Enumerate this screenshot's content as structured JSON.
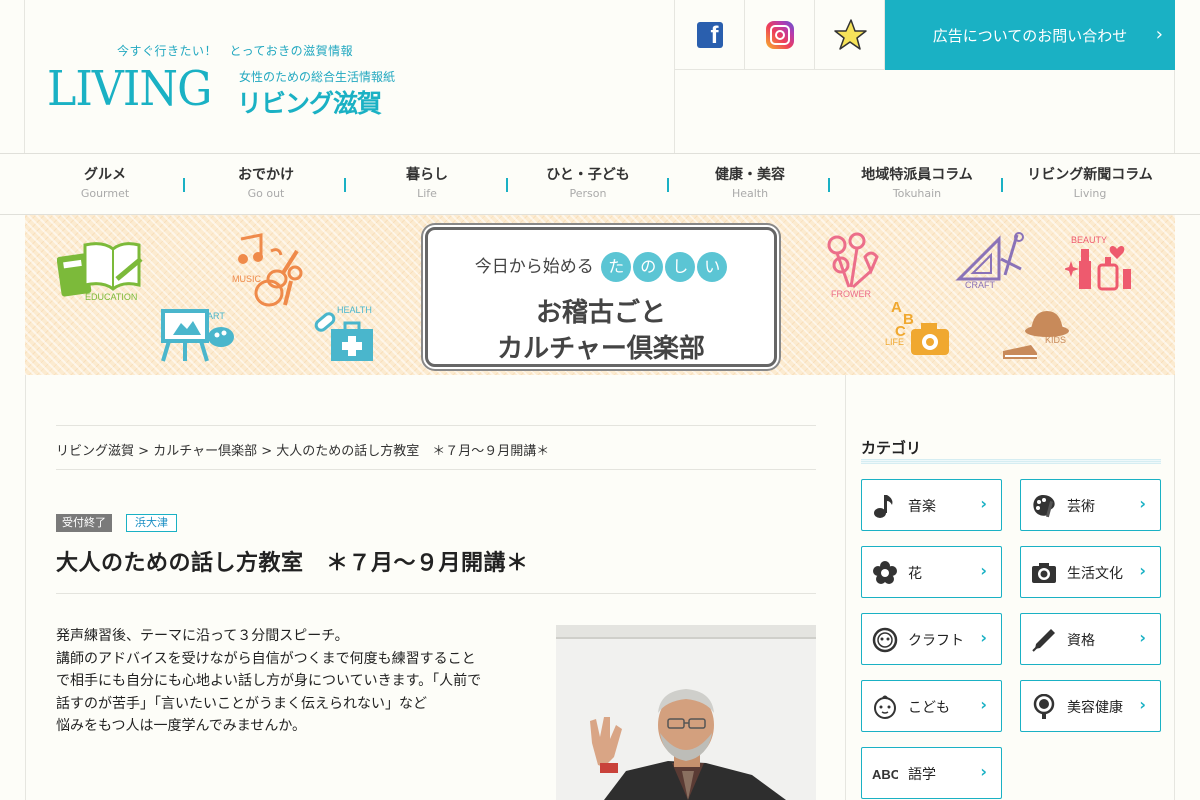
{
  "header": {
    "tagline": "今すぐ行きたい！　とっておきの滋賀情報",
    "logo_living": "LIVING",
    "logo_subtitle": "女性のための総合生活情報紙",
    "logo_name": "リビング滋賀",
    "ad_contact_label": "広告についてのお問い合わせ",
    "social": [
      "facebook-icon",
      "instagram-icon",
      "star-icon"
    ]
  },
  "nav": [
    {
      "jp": "グルメ",
      "en": "Gourmet"
    },
    {
      "jp": "おでかけ",
      "en": "Go out"
    },
    {
      "jp": "暮らし",
      "en": "Life"
    },
    {
      "jp": "ひと・子ども",
      "en": "Person"
    },
    {
      "jp": "健康・美容",
      "en": "Health"
    },
    {
      "jp": "地域特派員コラム",
      "en": "Tokuhain"
    },
    {
      "jp": "リビング新聞コラム",
      "en": "Living"
    }
  ],
  "banner": {
    "lead": "今日から始める",
    "tanoshii": [
      "た",
      "の",
      "し",
      "い"
    ],
    "title_line1": "お稽古ごと",
    "title_line2": "カルチャー倶楽部",
    "labels": {
      "education": "EDUCATION",
      "music": "MUSIC",
      "art": "ART",
      "health": "HEALTH",
      "flower": "FROWER",
      "craft": "CRAFT",
      "beauty": "BEAUTY",
      "life": "LIFE",
      "kids": "KIDS",
      "abc": [
        "A",
        "B",
        "C"
      ]
    },
    "colors": {
      "education": "#7cba3a",
      "music": "#ef8a4a",
      "art": "#4ab6cc",
      "health": "#4ab6cc",
      "flower": "#ec6e8a",
      "craft": "#8a72b8",
      "beauty": "#ee5a6e",
      "life": "#f0a830",
      "kids": "#c88a5a"
    }
  },
  "breadcrumb": {
    "home": "リビング滋賀",
    "section": "カルチャー倶楽部",
    "current": "大人のための話し方教室　＊７月～９月開講＊",
    "sep": ">"
  },
  "article": {
    "status_badge": "受付終了",
    "area_badge": "浜大津",
    "title": "大人のための話し方教室　＊７月～９月開講＊",
    "description": [
      "発声練習後、テーマに沿って３分間スピーチ。",
      "講師のアドバイスを受けながら自信がつくまで何度も練習すること",
      "で相手にも自分にも心地よい話し方が身についていきます。「人前で",
      "話すのが苦手」「言いたいことがうまく伝えられない」など",
      "悩みをもつ人は一度学んでみませんか。"
    ]
  },
  "sidebar": {
    "title": "カテゴリ",
    "categories": [
      {
        "label": "音楽",
        "icon": "music-note-icon"
      },
      {
        "label": "芸術",
        "icon": "palette-icon"
      },
      {
        "label": "花",
        "icon": "flower-icon"
      },
      {
        "label": "生活文化",
        "icon": "camera-icon"
      },
      {
        "label": "クラフト",
        "icon": "button-icon"
      },
      {
        "label": "資格",
        "icon": "pen-icon"
      },
      {
        "label": "こども",
        "icon": "baby-face-icon"
      },
      {
        "label": "美容健康",
        "icon": "mirror-icon"
      },
      {
        "label": "語学",
        "icon": "abc-icon"
      }
    ]
  },
  "colors": {
    "accent": "#1ab1c4",
    "badge_gray": "#7a7a7a"
  }
}
